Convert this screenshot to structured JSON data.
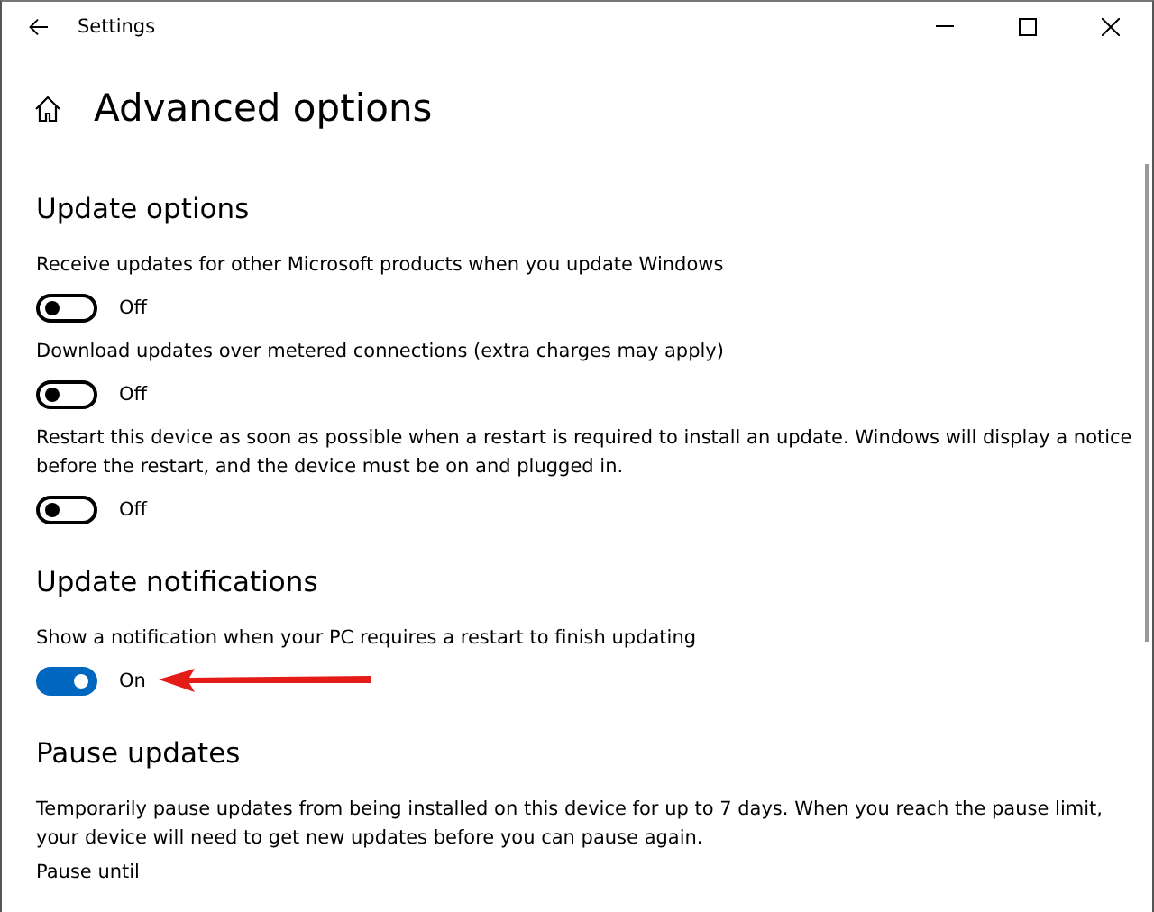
{
  "window": {
    "title": "Settings"
  },
  "page": {
    "title": "Advanced options"
  },
  "sections": [
    {
      "title": "Update options",
      "items": [
        {
          "kind": "toggle",
          "label": "Receive updates for other Microsoft products when you update Windows",
          "on": false,
          "state_text": "Off"
        },
        {
          "kind": "toggle",
          "label": "Download updates over metered connections (extra charges may apply)",
          "on": false,
          "state_text": "Off"
        },
        {
          "kind": "toggle",
          "label": "Restart this device as soon as possible when a restart is required to install an update. Windows will display a notice before the restart, and the device must be on and plugged in.",
          "on": false,
          "state_text": "Off"
        }
      ]
    },
    {
      "title": "Update notifications",
      "items": [
        {
          "kind": "toggle",
          "label": "Show a notification when your PC requires a restart to finish updating",
          "on": true,
          "state_text": "On",
          "arrow_callout": true
        }
      ]
    },
    {
      "title": "Pause updates",
      "items": [
        {
          "kind": "text",
          "label": "Temporarily pause updates from being installed on this device for up to 7 days. When you reach the pause limit, your device will need to get new updates before you can pause again."
        },
        {
          "kind": "caption",
          "label": "Pause until"
        }
      ]
    }
  ]
}
